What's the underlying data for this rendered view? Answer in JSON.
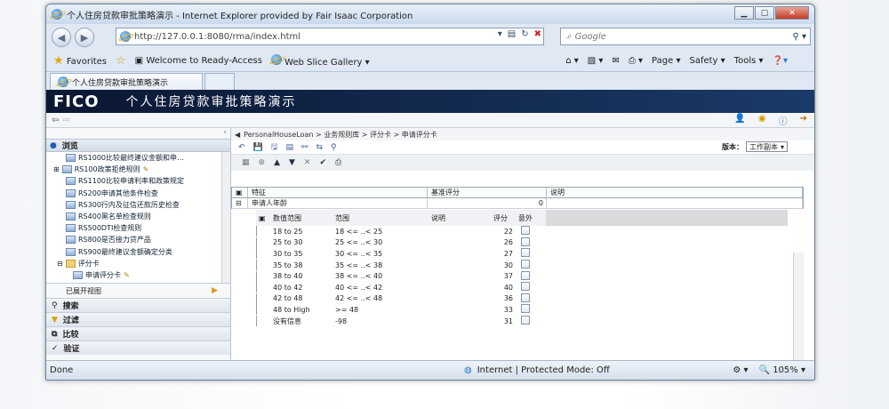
{
  "window": {
    "title": "个人住房贷款审批策略演示 - Internet Explorer provided by Fair Isaac Corporation"
  },
  "address": {
    "url": "http://127.0.0.1:8080/rma/index.html"
  },
  "search": {
    "placeholder": "Google"
  },
  "favorites": {
    "label": "Favorites",
    "item1": "Welcome to Ready-Access",
    "item2": "Web Slice Gallery"
  },
  "commands": {
    "page": "Page",
    "safety": "Safety",
    "tools": "Tools"
  },
  "tab": {
    "label": "个人住房贷款审批策略演示"
  },
  "app": {
    "logo": "FICO",
    "title": "个人住房贷款审批策略演示"
  },
  "left": {
    "browse": "浏览",
    "tree": [
      "RS1000比较最终建议金额和申…",
      "RS100政策拒绝规则",
      "RS1100比较申请利率和政策规定",
      "RS200申请其他条件检查",
      "RS300行内及征信还款历史检查",
      "RS400黑名单检查规则",
      "RS500DTI检查规则",
      "RS800是否接力贷产品",
      "RS900最终建议金额确定分类",
      "评分卡",
      "申请评分卡"
    ],
    "expand_view": "已展开视图",
    "sections": [
      "搜索",
      "过滤",
      "比较",
      "验证"
    ]
  },
  "breadcrumb": "PersonalHouseLoan > 业务规则库 > 评分卡 > 申请评分卡",
  "version": {
    "label": "版本：",
    "value": "工作副本"
  },
  "grid": {
    "headers": [
      "特征",
      "基准评分",
      "说明"
    ],
    "row": {
      "name": "申请人年龄",
      "score": "0"
    },
    "sub_headers": [
      "数值范围",
      "范围",
      "说明",
      "评分",
      "意外"
    ],
    "rows": [
      {
        "label": "18 to 25",
        "range": "18 <= ..< 25",
        "score": "22"
      },
      {
        "label": "25 to 30",
        "range": "25 <= ..< 30",
        "score": "26"
      },
      {
        "label": "30 to 35",
        "range": "30 <= ..< 35",
        "score": "27"
      },
      {
        "label": "35 to 38",
        "range": "35 <= ..< 38",
        "score": "30"
      },
      {
        "label": "38 to 40",
        "range": "38 <= ..< 40",
        "score": "37"
      },
      {
        "label": "40 to 42",
        "range": "40 <= ..< 42",
        "score": "40"
      },
      {
        "label": "42 to 48",
        "range": "42 <= ..< 48",
        "score": "36"
      },
      {
        "label": "48 to High",
        "range": ">= 48",
        "score": "33"
      },
      {
        "label": "没有信息",
        "range": "-98",
        "score": "31"
      }
    ]
  },
  "status": {
    "left": "Done",
    "zone": "Internet | Protected Mode: Off",
    "zoom": "105%"
  }
}
